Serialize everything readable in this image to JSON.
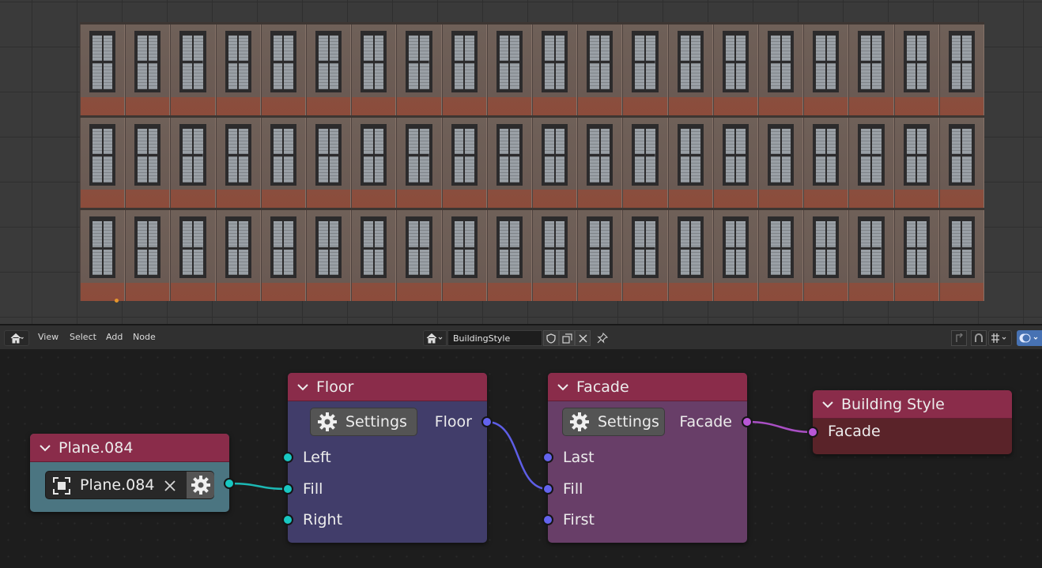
{
  "header": {
    "menus": [
      "View",
      "Select",
      "Add",
      "Node"
    ],
    "node_tree_name": "BuildingStyle",
    "icons": {
      "editor_type": "home-icon",
      "tree_type": "home-icon",
      "fake_user": "shield-icon",
      "duplicate": "duplicate-icon",
      "unlink": "close-icon",
      "pin": "pin-icon",
      "parent": "arrow-up-icon",
      "snap": "magnet-icon",
      "snap_mode": "grid-icon",
      "overlay": "overlay-icon"
    }
  },
  "viewport": {
    "object": "building-facade",
    "stories": 3,
    "bays_per_story": 20
  },
  "nodes": {
    "plane": {
      "title": "Plane.084",
      "object_field": "Plane.084",
      "header_color": "#8a2c4a",
      "body_color": "#4b7581"
    },
    "floor": {
      "title": "Floor",
      "settings_label": "Settings",
      "output_label": "Floor",
      "inputs": [
        "Left",
        "Fill",
        "Right"
      ],
      "header_color": "#8a2c4a",
      "body_color": "#413d6a"
    },
    "facade": {
      "title": "Facade",
      "settings_label": "Settings",
      "output_label": "Facade",
      "inputs": [
        "Last",
        "Fill",
        "First"
      ],
      "header_color": "#8a2c4a",
      "body_color": "#683e68"
    },
    "building_style": {
      "title": "Building Style",
      "inputs": [
        "Facade"
      ],
      "header_color": "#8a2c4a",
      "body_color": "#5a2329"
    }
  },
  "socket_colors": {
    "object": "#18c7c2",
    "floor": "#6363ee",
    "facade": "#b957d6"
  }
}
